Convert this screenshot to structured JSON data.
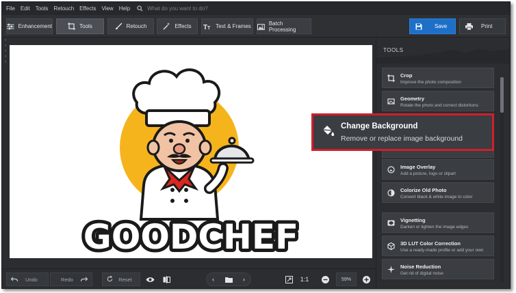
{
  "menu": [
    "File",
    "Edit",
    "Tools",
    "Retouch",
    "Effects",
    "View",
    "Help"
  ],
  "search": {
    "placeholder": "What do you want to do?"
  },
  "toolbar": {
    "tabs": [
      {
        "label": "Enhancement",
        "icon": "sliders-icon"
      },
      {
        "label": "Tools",
        "icon": "crop-icon",
        "active": true
      },
      {
        "label": "Retouch",
        "icon": "brush-icon"
      },
      {
        "label": "Effects",
        "icon": "magic-wand-icon"
      },
      {
        "label": "Text & Frames",
        "icon": "text-icon"
      },
      {
        "label": "Batch Processing",
        "icon": "images-icon"
      }
    ],
    "save_label": "Save",
    "print_label": "Print"
  },
  "canvas": {
    "logo_text": "GOODCHEF"
  },
  "panel": {
    "title": "TOOLS",
    "items": [
      {
        "title": "Crop",
        "desc": "Improve the photo composition",
        "icon": "crop-icon"
      },
      {
        "title": "Geometry",
        "desc": "Rotate the photo and correct distortions",
        "icon": "geometry-icon"
      },
      {
        "title": "Image Overlay",
        "desc": "Add a picture, logo or clipart",
        "icon": "overlay-icon"
      },
      {
        "title": "Colorize Old Photo",
        "desc": "Convert black & white image to color",
        "icon": "colorize-icon"
      },
      {
        "title": "Vignetting",
        "desc": "Darken or lighten the image edges",
        "icon": "vignette-icon"
      },
      {
        "title": "3D LUT Color Correction",
        "desc": "Use a ready-made profile or add your own",
        "icon": "lut-icon"
      },
      {
        "title": "Noise Reduction",
        "desc": "Get rid of digital noise",
        "icon": "noise-icon"
      }
    ]
  },
  "callout": {
    "title": "Change Background",
    "desc": "Remove or replace image background",
    "icon": "paint-bucket-icon"
  },
  "bottom": {
    "undo": "Undo",
    "redo": "Redo",
    "reset": "Reset",
    "ratio": "1:1",
    "zoom": "59%"
  },
  "colors": {
    "accent": "#1e6fc8",
    "highlight": "#d21f2b",
    "chef_circle": "#f6b41c"
  }
}
